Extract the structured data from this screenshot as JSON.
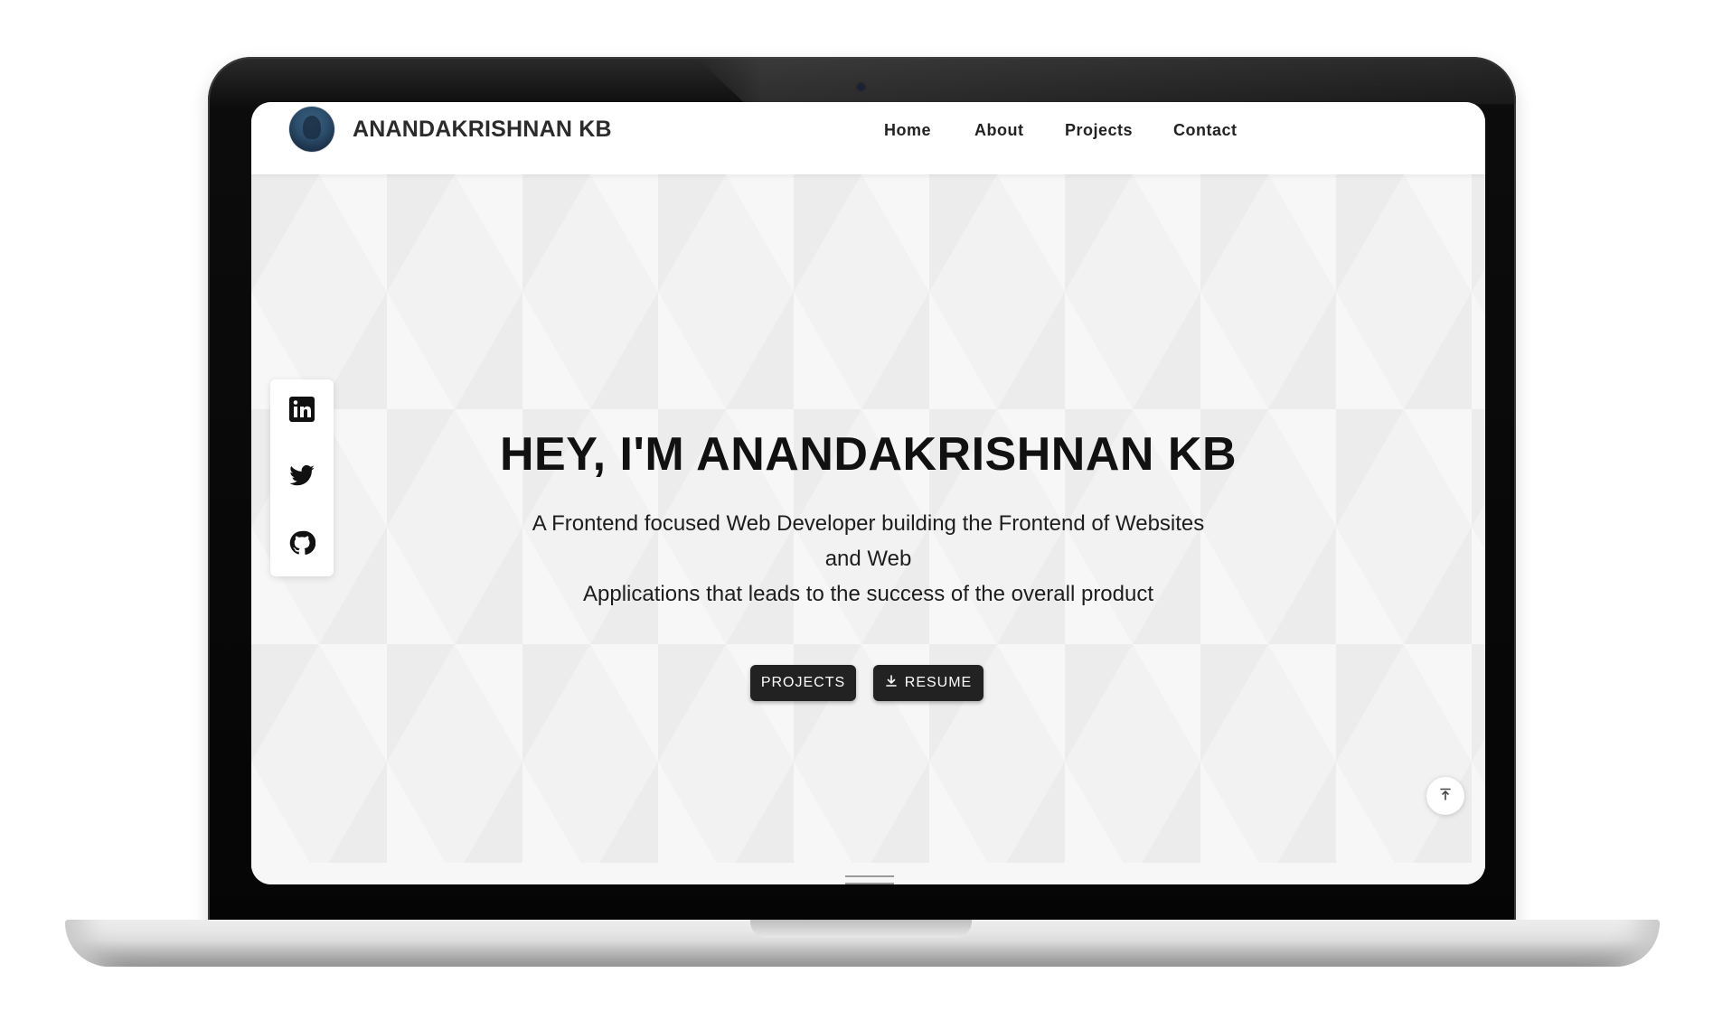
{
  "navbar": {
    "brand": "ANANDAKRISHNAN KB",
    "links": [
      "Home",
      "About",
      "Projects",
      "Contact"
    ]
  },
  "hero": {
    "title": "HEY, I'M ANANDAKRISHNAN KB",
    "subtitle_lines": [
      "A Frontend focused Web Developer building the Frontend of Websites",
      "and Web",
      "Applications that leads to the success of the overall product"
    ],
    "buttons": {
      "projects": "PROJECTS",
      "resume": "RESUME"
    }
  },
  "social_icons": [
    "linkedin-icon",
    "twitter-icon",
    "github-icon"
  ],
  "scroll_top_icon": "arrow-up-to-top-icon",
  "colors": {
    "button_bg": "#222222",
    "hero_bg": "#f2f2f2",
    "nav_bg": "#ffffff"
  }
}
